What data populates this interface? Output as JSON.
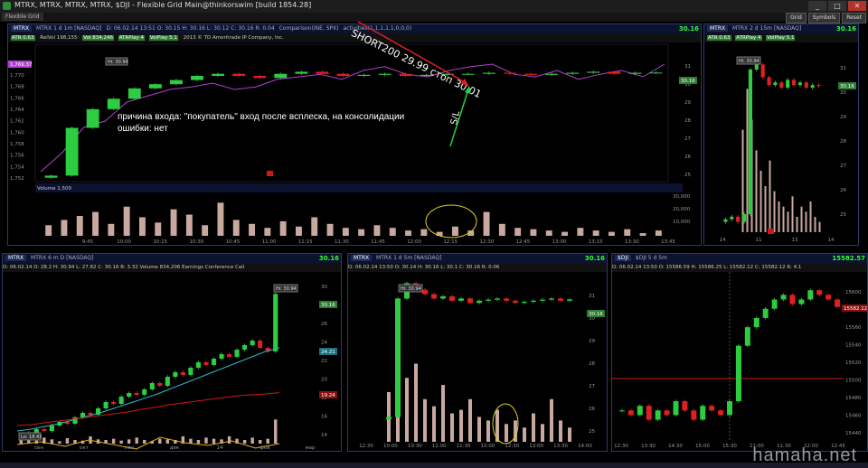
{
  "window": {
    "title": "MTRX, MTRX, MTRX, MTRX, $DJI - Flexible Grid Main@thinkorswim [build 1854.28]",
    "tag": "Flexible Grid",
    "buttons": {
      "grid": "Grid",
      "symbols": "Symbols",
      "reset": "Reset"
    }
  },
  "panels": {
    "main": {
      "symbol": "MTRX",
      "head": "MTRX 1 d 1m [NASDAQ]",
      "info": "D: 06.02.14 13:51  O: 30.15  H: 30.16  L: 30.12  C: 30.16  R: 0.04",
      "price": "30.16",
      "study_labels": [
        "ATR 0.63",
        "RelVol 198,155",
        "Vol 834,246",
        "ATRPlay 4",
        "VolPlay 5.1"
      ],
      "copyright": "2013 © TD Ameritrade IP Company, Inc.",
      "comparison": "Comparison(INE, SPX)",
      "activities": "activities(1,1,1,1,1,0,0,0)",
      "left_price_tag": "1,769.37",
      "price_axis": [
        "1,770",
        "1,768",
        "1,766",
        "1,764",
        "1,762",
        "1,760",
        "1,758",
        "1,756",
        "1,754",
        "1,752"
      ],
      "right_axis": [
        "31",
        "30",
        "29",
        "28",
        "27",
        "26",
        "25"
      ],
      "time_axis": [
        "9:45",
        "10:00",
        "10:15",
        "10:30",
        "10:45",
        "11:00",
        "11:15",
        "11:30",
        "11:45",
        "12:00",
        "12:15",
        "12:30",
        "12:45",
        "13:00",
        "13:15",
        "13:30",
        "13:45"
      ],
      "volume_label": "Volume 1,500",
      "vol_axis": [
        "30,000",
        "20,000",
        "10,000"
      ],
      "hi_label": "Hi: 30.94"
    },
    "small": {
      "head": "MTRX 2 d 15m [NASDAQ]",
      "price": "30.16",
      "study_labels": [
        "ATR 0.63",
        "ATRPlay 4",
        "VolPlay 5.1"
      ],
      "hi_label": "Hi: 30.94",
      "price_axis": [
        "31",
        "30",
        "29",
        "28",
        "27",
        "26",
        "25"
      ],
      "time_axis": [
        "14",
        "11",
        "13",
        "14"
      ]
    },
    "daily": {
      "head": "MTRX 6 m D [NASDAQ]",
      "info": "D: 06.02.14  O: 28.2  H: 30.94  L: 27.82  C: 30.16  R: 3.32  Volume 834,206  Earnings Conference Call",
      "price": "30.16",
      "hi_label": "Hi: 30.94",
      "lo_label": "Lo: 18.43",
      "price_axis": [
        "30",
        "28",
        "26",
        "24",
        "22",
        "20",
        "18",
        "16",
        "14"
      ],
      "time_axis": [
        "сен",
        "окт",
        "ноя",
        "дек",
        "14",
        "фев",
        "мар"
      ],
      "tags": {
        "ma1": "24.21",
        "ma2": "19.24"
      }
    },
    "fivemin": {
      "head": "MTRX 1 d 5m [NASDAQ]",
      "info": "D: 06.02.14 13:50  O: 30.14  H: 30.16  L: 30.1  C: 30.16  R: 0.06",
      "price": "30.16",
      "hi_label": "Hi: 30.94",
      "price_axis": [
        "31",
        "30",
        "29",
        "28",
        "27",
        "26",
        "25"
      ],
      "time_axis": [
        "12:30",
        "10:00",
        "10:30",
        "11:00",
        "11:30",
        "12:00",
        "12:30",
        "13:00",
        "13:30",
        "14:00"
      ]
    },
    "dji": {
      "head": "$DJI 5 d 5m",
      "info": "D: 06.02.14 13:50  O: 15586.59  H: 15586.25  L: 15582.12  C: 15582.12  R: 4.1",
      "price": "15582.57",
      "current_tag": "15582.12",
      "price_axis": [
        "15600",
        "15580",
        "15560",
        "15540",
        "15520",
        "15500",
        "15480",
        "15460",
        "15440"
      ],
      "time_axis": [
        "12:30",
        "13:30",
        "14:30",
        "15:00",
        "15:30",
        "11:00",
        "11:30",
        "12:00",
        "12:45"
      ]
    }
  },
  "annotations": {
    "short": "SHORT200 29.99 стоп 30,01",
    "sl": "S/L",
    "reason_line1": "причина входа: \"покупатель\" вход после всплеска, на консолидации",
    "reason_line2": "ошибки: нет"
  },
  "watermark": "hamaha.net",
  "colors": {
    "up": "#2ecc40",
    "down": "#e02020",
    "volume": "#c9a8a0",
    "compare": "#b040d0",
    "ma_cyan": "#2fb7c8",
    "ma_red": "#d01818",
    "ma_yellow": "#e0b020"
  },
  "chart_data": [
    {
      "type": "line",
      "name": "MTRX 1m",
      "ylim": [
        25,
        31
      ],
      "series": [
        {
          "name": "price",
          "values": [
            25.2,
            27.5,
            28.4,
            28.9,
            29.4,
            29.6,
            29.8,
            30.0,
            30.1,
            30.0,
            29.9,
            30.1,
            30.2,
            30.1,
            30.0,
            30.05,
            30.1,
            30.0,
            30.05,
            30.1,
            30.1,
            30.15,
            30.1,
            30.05,
            30.1,
            30.15,
            30.2,
            30.1,
            30.15,
            30.16
          ]
        }
      ]
    },
    {
      "type": "bar",
      "name": "MTRX 1m volume",
      "ylim": [
        0,
        30000
      ],
      "values": [
        8000,
        12000,
        15000,
        18000,
        9000,
        22000,
        14000,
        10000,
        20000,
        16000,
        8000,
        25000,
        12000,
        9000,
        6000,
        11000,
        7000,
        14000,
        9000,
        6000,
        5000,
        8000,
        6000,
        4000,
        5000,
        3000,
        7000,
        4000,
        18000,
        9000,
        6000,
        5000,
        4000,
        3000,
        6000,
        4000,
        3000,
        5000,
        2000,
        4000
      ]
    },
    {
      "type": "line",
      "name": "MTRX 6m D",
      "ylim": [
        14,
        32
      ],
      "series": [
        {
          "name": "close",
          "values": [
            14.5,
            14.8,
            15.2,
            15.0,
            15.6,
            16.0,
            15.8,
            16.5,
            17.0,
            16.8,
            17.5,
            18.2,
            18.0,
            18.8,
            19.2,
            19.0,
            19.6,
            20.3,
            20.0,
            21.0,
            21.5,
            21.2,
            22.0,
            22.6,
            22.3,
            23.0,
            23.5,
            23.2,
            24.0,
            24.5,
            25.0,
            24.2,
            23.8,
            30.16
          ]
        }
      ]
    },
    {
      "type": "line",
      "name": "MTRX 5m",
      "ylim": [
        24,
        31
      ],
      "series": [
        {
          "name": "close",
          "values": [
            24.8,
            30.2,
            30.9,
            30.6,
            30.4,
            30.2,
            30.3,
            30.1,
            30.2,
            30.0,
            30.1,
            30.15,
            30.2,
            30.1,
            30.0,
            30.05,
            30.1,
            30.15,
            30.2,
            30.1,
            30.16
          ]
        }
      ]
    },
    {
      "type": "line",
      "name": "$DJI 5d 5m",
      "ylim": [
        15440,
        15610
      ],
      "series": [
        {
          "name": "close",
          "values": [
            15470,
            15465,
            15475,
            15460,
            15470,
            15465,
            15480,
            15470,
            15460,
            15475,
            15470,
            15465,
            15480,
            15540,
            15560,
            15570,
            15580,
            15590,
            15595,
            15585,
            15590,
            15600,
            15595,
            15590,
            15582
          ]
        }
      ]
    }
  ]
}
